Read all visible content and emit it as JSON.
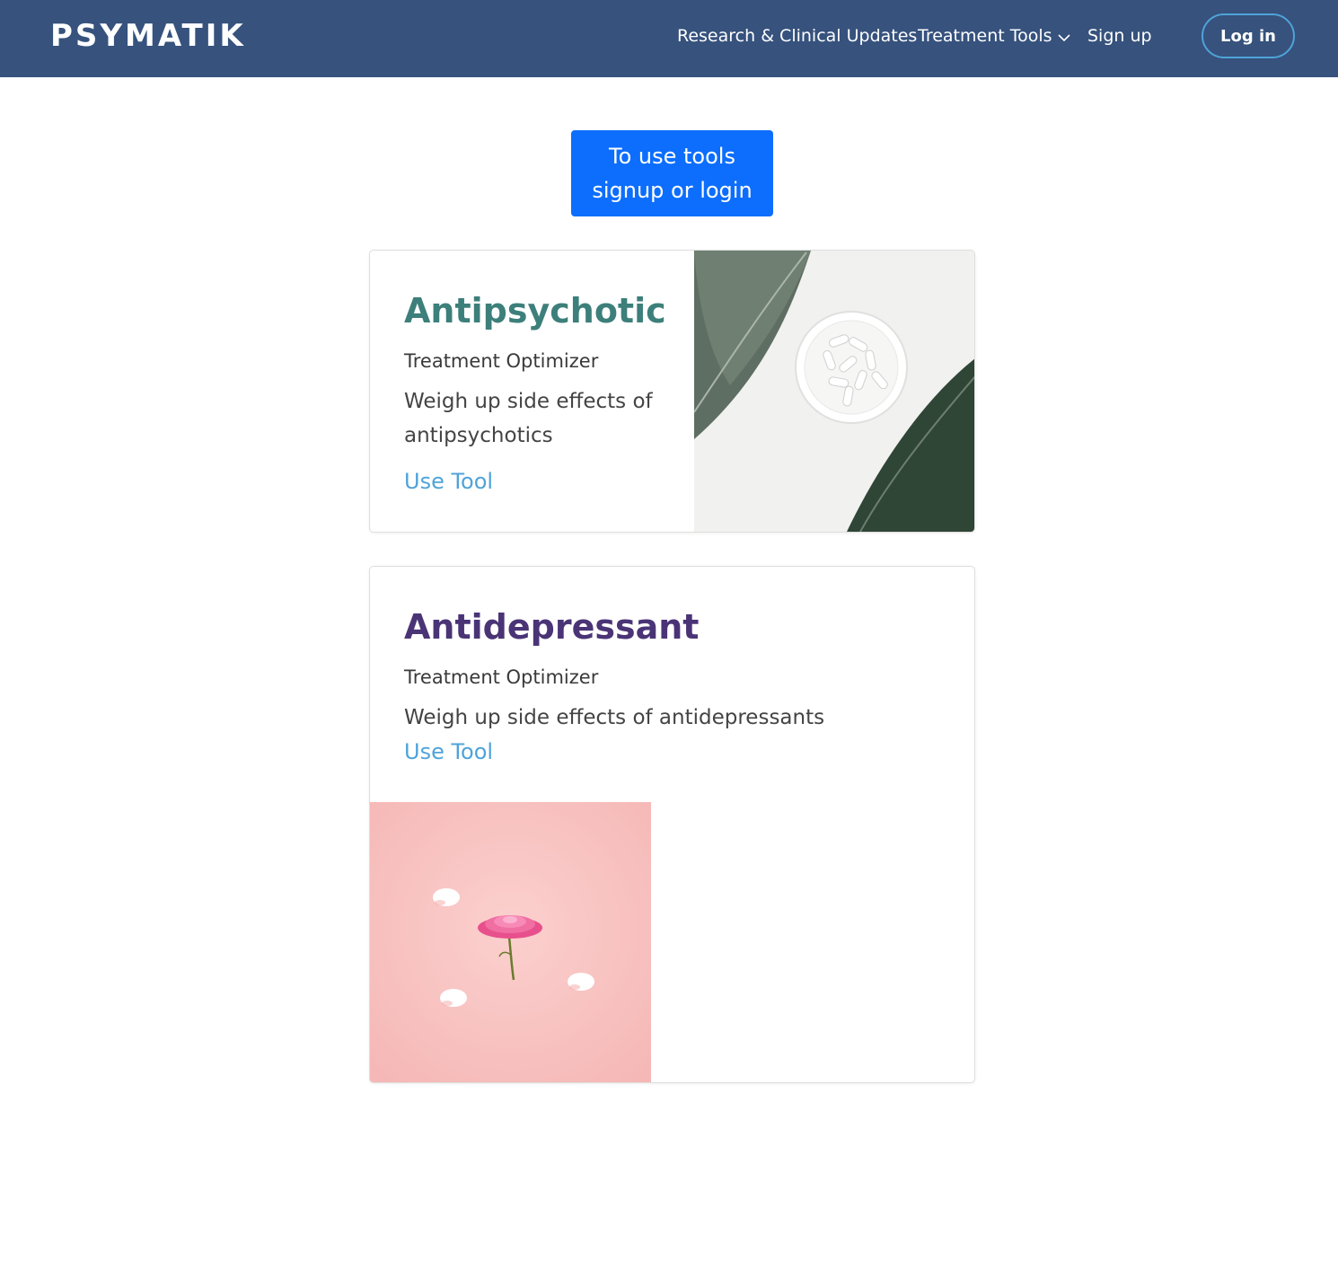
{
  "header": {
    "brand": "PSYMATIK",
    "nav": {
      "research": "Research & Clinical Updates",
      "tools": "Treatment Tools",
      "signup": "Sign up",
      "login": "Log in"
    }
  },
  "cta": {
    "line1": "To use tools",
    "line2": "signup or login"
  },
  "cards": [
    {
      "title": "Antipsychotic",
      "subtitle": "Treatment Optimizer",
      "description": "Weigh up side effects of antipsychotics",
      "link": "Use Tool"
    },
    {
      "title": "Antidepressant",
      "subtitle": "Treatment Optimizer",
      "description": "Weigh up side effects of antidepressants",
      "link": "Use Tool"
    }
  ],
  "colors": {
    "navbar": "#36527d",
    "cta": "#0d6efd",
    "link": "#4fa3d9",
    "antipsychotic_title": "#3d7f7a",
    "antidepressant_title": "#4a3476"
  }
}
